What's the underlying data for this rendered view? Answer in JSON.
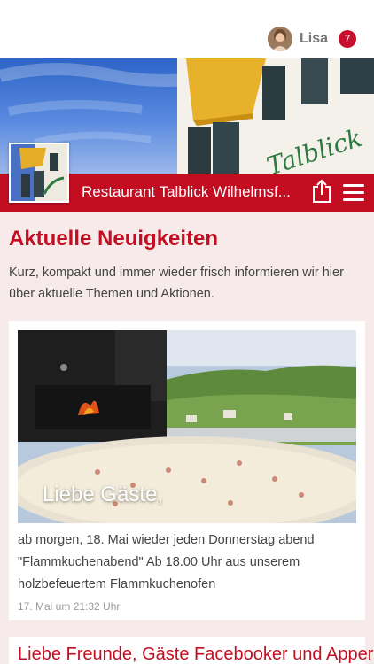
{
  "user": {
    "name": "Lisa",
    "notification_count": "7"
  },
  "header": {
    "title": "Restaurant Talblick Wilhelmsf...",
    "building_sign": "Talblick"
  },
  "news": {
    "title": "Aktuelle Neuigkeiten",
    "description": "Kurz, kompakt und immer wieder frisch informieren wir hier über aktuelle Themen und Aktionen.",
    "posts": [
      {
        "image_caption": "Liebe Gäste,",
        "text": "ab morgen, 18. Mai wieder jeden Donnerstag abend \"Flammkuchenabend\" Ab 18.00 Uhr aus unserem holzbefeuertem Flammkuchenofen",
        "date": "17. Mai um 21:32 Uhr"
      },
      {
        "title": "Liebe Freunde, Gäste Facebooker und Apper,"
      }
    ]
  },
  "colors": {
    "accent": "#c30e22",
    "background": "#f7eaea",
    "badge": "#c8102e"
  }
}
